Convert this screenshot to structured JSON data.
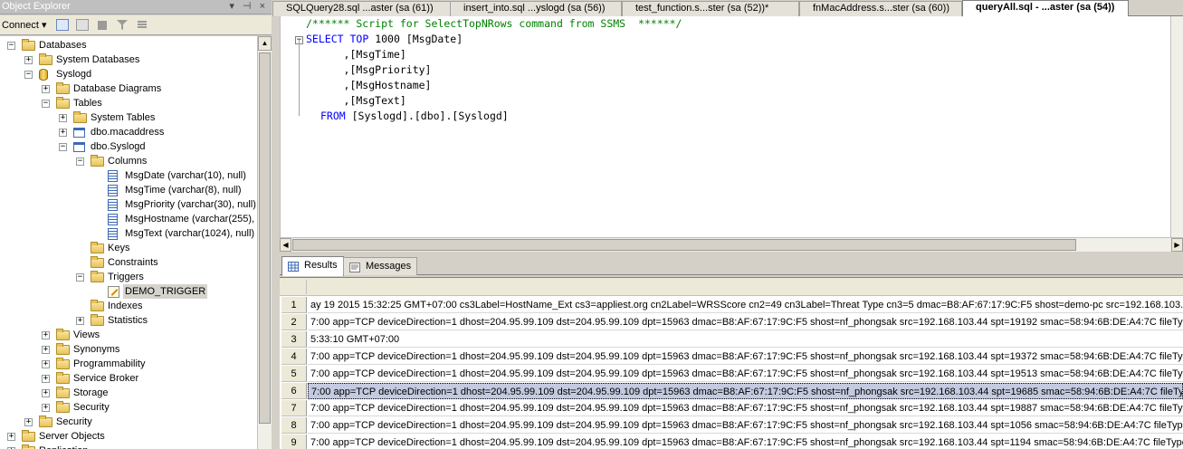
{
  "object_explorer": {
    "title": "Object Explorer",
    "title_buttons": "▾ ⊣ ×",
    "connect_label": "Connect ▾",
    "tree": [
      {
        "label": "Databases",
        "exp": "−",
        "icon": "folder"
      },
      {
        "label": "System Databases",
        "exp": "+",
        "icon": "folder"
      },
      {
        "label": "Syslogd",
        "exp": "−",
        "icon": "database"
      },
      {
        "label": "Database Diagrams",
        "exp": "+",
        "icon": "folder"
      },
      {
        "label": "Tables",
        "exp": "−",
        "icon": "folder"
      },
      {
        "label": "System Tables",
        "exp": "+",
        "icon": "folder"
      },
      {
        "label": "dbo.macaddress",
        "exp": "+",
        "icon": "table"
      },
      {
        "label": "dbo.Syslogd",
        "exp": "−",
        "icon": "table"
      },
      {
        "label": "Columns",
        "exp": "−",
        "icon": "folder"
      },
      {
        "label": "MsgDate (varchar(10), null)",
        "exp": "",
        "icon": "column"
      },
      {
        "label": "MsgTime (varchar(8), null)",
        "exp": "",
        "icon": "column"
      },
      {
        "label": "MsgPriority (varchar(30), null)",
        "exp": "",
        "icon": "column"
      },
      {
        "label": "MsgHostname (varchar(255), null)",
        "exp": "",
        "icon": "column"
      },
      {
        "label": "MsgText (varchar(1024), null)",
        "exp": "",
        "icon": "column"
      },
      {
        "label": "Keys",
        "exp": "",
        "icon": "folder"
      },
      {
        "label": "Constraints",
        "exp": "",
        "icon": "folder"
      },
      {
        "label": "Triggers",
        "exp": "−",
        "icon": "folder"
      },
      {
        "label": "DEMO_TRIGGER",
        "exp": "",
        "icon": "trigger"
      },
      {
        "label": "Indexes",
        "exp": "",
        "icon": "folder"
      },
      {
        "label": "Statistics",
        "exp": "+",
        "icon": "folder"
      },
      {
        "label": "Views",
        "exp": "+",
        "icon": "folder"
      },
      {
        "label": "Synonyms",
        "exp": "+",
        "icon": "folder"
      },
      {
        "label": "Programmability",
        "exp": "+",
        "icon": "folder"
      },
      {
        "label": "Service Broker",
        "exp": "+",
        "icon": "folder"
      },
      {
        "label": "Storage",
        "exp": "+",
        "icon": "folder"
      },
      {
        "label": "Security",
        "exp": "+",
        "icon": "folder"
      },
      {
        "label": "Security",
        "exp": "+",
        "icon": "folder"
      },
      {
        "label": "Server Objects",
        "exp": "+",
        "icon": "folder"
      },
      {
        "label": "Replication",
        "exp": "+",
        "icon": "folder"
      }
    ]
  },
  "tabs": [
    {
      "label": "SQLQuery28.sql ...aster (sa (61))",
      "active": false
    },
    {
      "label": "insert_into.sql ...yslogd (sa (56))",
      "active": false
    },
    {
      "label": "test_function.s...ster (sa (52))*",
      "active": false
    },
    {
      "label": "fnMacAddress.s...ster (sa (60))",
      "active": false
    },
    {
      "label": "queryAll.sql - ...aster (sa (54))",
      "active": true
    }
  ],
  "editor": {
    "line1_comment": "/****** Script for SelectTopNRows command from SSMS  ******/",
    "line2_select": "SELECT",
    "line2_top": "TOP",
    "line2_rest": " 1000 [MsgDate]",
    "line3": "      ,[MsgTime]",
    "line4": "      ,[MsgPriority]",
    "line5": "      ,[MsgHostname]",
    "line6": "      ,[MsgText]",
    "line7_from": "FROM",
    "line7_rest": " [Syslogd].[dbo].[Syslogd]"
  },
  "results_tabs": {
    "results": "Results",
    "messages": "Messages"
  },
  "grid": {
    "rows": [
      {
        "num": "1",
        "text": "ay 19 2015 15:32:25 GMT+07:00 cs3Label=HostName_Ext cs3=appliest.org cn2Label=WRSScore cn2=49 cn3Label=Threat Type cn3=5 dmac=B8:AF:67:17:9C:F5 shost=demo-pc src=192.168.103.18..."
      },
      {
        "num": "2",
        "text": "7:00 app=TCP deviceDirection=1 dhost=204.95.99.109 dst=204.95.99.109 dpt=15963 dmac=B8:AF:67:17:9C:F5 shost=nf_phongsak src=192.168.103.44 spt=19192 smac=58:94:6B:DE:A4:7C fileType..."
      },
      {
        "num": "3",
        "text": "5:33:10 GMT+07:00"
      },
      {
        "num": "4",
        "text": "7:00 app=TCP deviceDirection=1 dhost=204.95.99.109 dst=204.95.99.109 dpt=15963 dmac=B8:AF:67:17:9C:F5 shost=nf_phongsak src=192.168.103.44 spt=19372 smac=58:94:6B:DE:A4:7C fileType..."
      },
      {
        "num": "5",
        "text": "7:00 app=TCP deviceDirection=1 dhost=204.95.99.109 dst=204.95.99.109 dpt=15963 dmac=B8:AF:67:17:9C:F5 shost=nf_phongsak src=192.168.103.44 spt=19513 smac=58:94:6B:DE:A4:7C fileType..."
      },
      {
        "num": "6",
        "text": "7:00 app=TCP deviceDirection=1 dhost=204.95.99.109 dst=204.95.99.109 dpt=15963 dmac=B8:AF:67:17:9C:F5 shost=nf_phongsak src=192.168.103.44 spt=19685 smac=58:94:6B:DE:A4:7C fileType..."
      },
      {
        "num": "7",
        "text": "7:00 app=TCP deviceDirection=1 dhost=204.95.99.109 dst=204.95.99.109 dpt=15963 dmac=B8:AF:67:17:9C:F5 shost=nf_phongsak src=192.168.103.44 spt=19887 smac=58:94:6B:DE:A4:7C fileType..."
      },
      {
        "num": "8",
        "text": "7:00 app=TCP deviceDirection=1 dhost=204.95.99.109 dst=204.95.99.109 dpt=15963 dmac=B8:AF:67:17:9C:F5 shost=nf_phongsak src=192.168.103.44 spt=1056 smac=58:94:6B:DE:A4:7C fileType=..."
      },
      {
        "num": "9",
        "text": "7:00 app=TCP deviceDirection=1 dhost=204.95.99.109 dst=204.95.99.109 dpt=15963 dmac=B8:AF:67:17:9C:F5 shost=nf_phongsak src=192.168.103.44 spt=1194 smac=58:94:6B:DE:A4:7C fileType=..."
      }
    ],
    "selected_row": "6"
  }
}
